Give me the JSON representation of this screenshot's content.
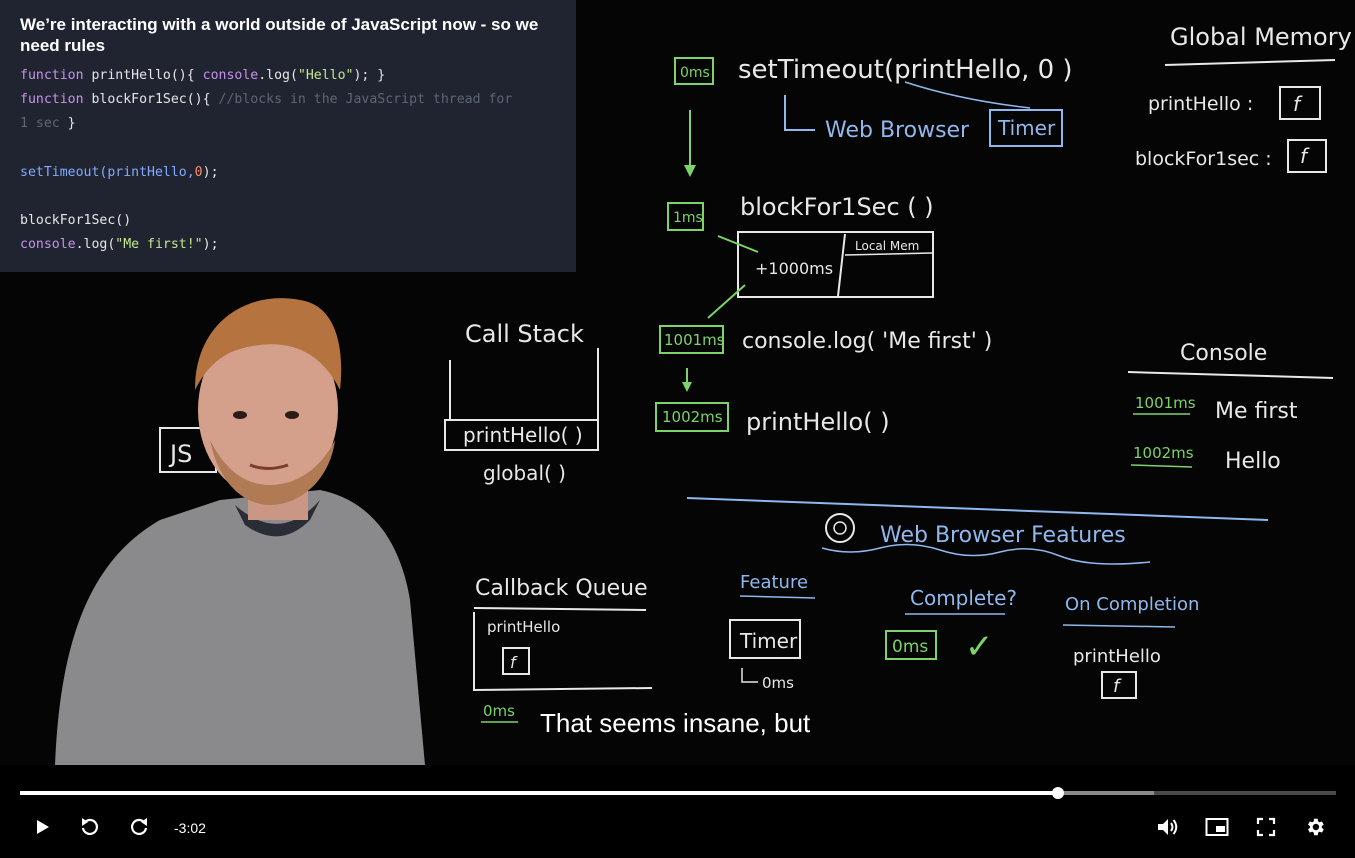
{
  "slide": {
    "title": "We’re interacting with a world outside of JavaScript now - so we need rules",
    "code": {
      "l1_kw": "function",
      "l1_fn": " printHello(){ ",
      "l1_obj": "console",
      "l1_call": ".log(",
      "l1_str": "\"Hello\"",
      "l1_end": "); }",
      "l2_kw": "function",
      "l2_fn": " blockFor1Sec(){ ",
      "l2_cmt": "//blocks in the JavaScript thread for",
      "l3_cmt": "1 sec",
      "l3_end": " }",
      "l5_call": "setTimeout(printHello,",
      "l5_num": "0",
      "l5_end": ");",
      "l7": "blockFor1Sec()",
      "l8_obj": "console",
      "l8_call": ".log(",
      "l8_str": "\"Me first!\"",
      "l8_end": ");"
    }
  },
  "caption": "That seems insane, but",
  "player": {
    "time_remaining": "-3:02",
    "progress_played": 0.789,
    "progress_buffered": 0.862
  },
  "board": {
    "global_memory": "Global Memory",
    "printHello": "printHello :",
    "blockFor1sec": "blockFor1sec :",
    "f": "f",
    "t0": "0ms",
    "setTimeout": "setTimeout(printHello, 0 )",
    "web_browser": "Web Browser",
    "timer": "Timer",
    "t1": "1ms",
    "blockFor1Sec": "blockFor1Sec ( )",
    "local_mem": "Local Mem",
    "plus1000": "+1000ms",
    "call_stack": "Call Stack",
    "stack_top": "printHello( )",
    "stack_global": "global( )",
    "t1001": "1001ms",
    "console_log": "console.log( 'Me first' )",
    "t1002": "1002ms",
    "printHello_call": "printHello( )",
    "console": "Console",
    "c_t1": "1001ms",
    "c_v1": "Me first",
    "c_t2": "1002ms",
    "c_v2": "Hello",
    "features_title": "Web Browser Features",
    "feature": "Feature",
    "complete": "Complete?",
    "on_completion": "On Completion",
    "feature_timer": "Timer",
    "feature_timer_ms": "0ms",
    "complete_ms": "0ms",
    "check": "✓",
    "on_completion_fn": "printHello",
    "callback_queue": "Callback Queue",
    "queue_item": "printHello",
    "queue_ms": "0ms",
    "js_box": "JS"
  },
  "colors": {
    "chalk_white": "#e8e8e8",
    "chalk_green": "#7cd36a",
    "chalk_blue": "#8fb8ee",
    "slide_bg": "#1f2430"
  }
}
